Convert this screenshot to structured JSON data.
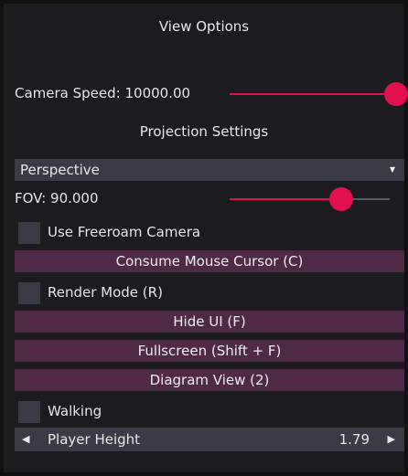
{
  "panel": {
    "title": "View Options",
    "camera_speed": {
      "label": "Camera Speed: 10000.00",
      "fraction": 1.0
    },
    "projection_title": "Projection Settings",
    "projection_mode": "Perspective",
    "dropdown_arrow": "▼",
    "fov": {
      "label": "FOV: 90.000",
      "fraction": 0.7
    },
    "freeroam": {
      "label": "Use Freeroam Camera",
      "checked": true
    },
    "consume_mouse_label": "Consume Mouse Cursor (C)",
    "render_mode": {
      "label": "Render Mode (R)",
      "checked": false
    },
    "hide_ui_label": "Hide UI (F)",
    "fullscreen_label": "Fullscreen (Shift + F)",
    "diagram_view_label": "Diagram View (2)",
    "walking": {
      "label": "Walking",
      "checked": false
    },
    "player_height": {
      "label": "Player Height",
      "value": "1.79",
      "left_arrow": "◀",
      "right_arrow": "▶"
    }
  },
  "colors": {
    "accent": "#e31050",
    "button_bg": "#4e2a47",
    "control_bg": "#3b3b46",
    "panel_bg": "#1c1c20"
  }
}
